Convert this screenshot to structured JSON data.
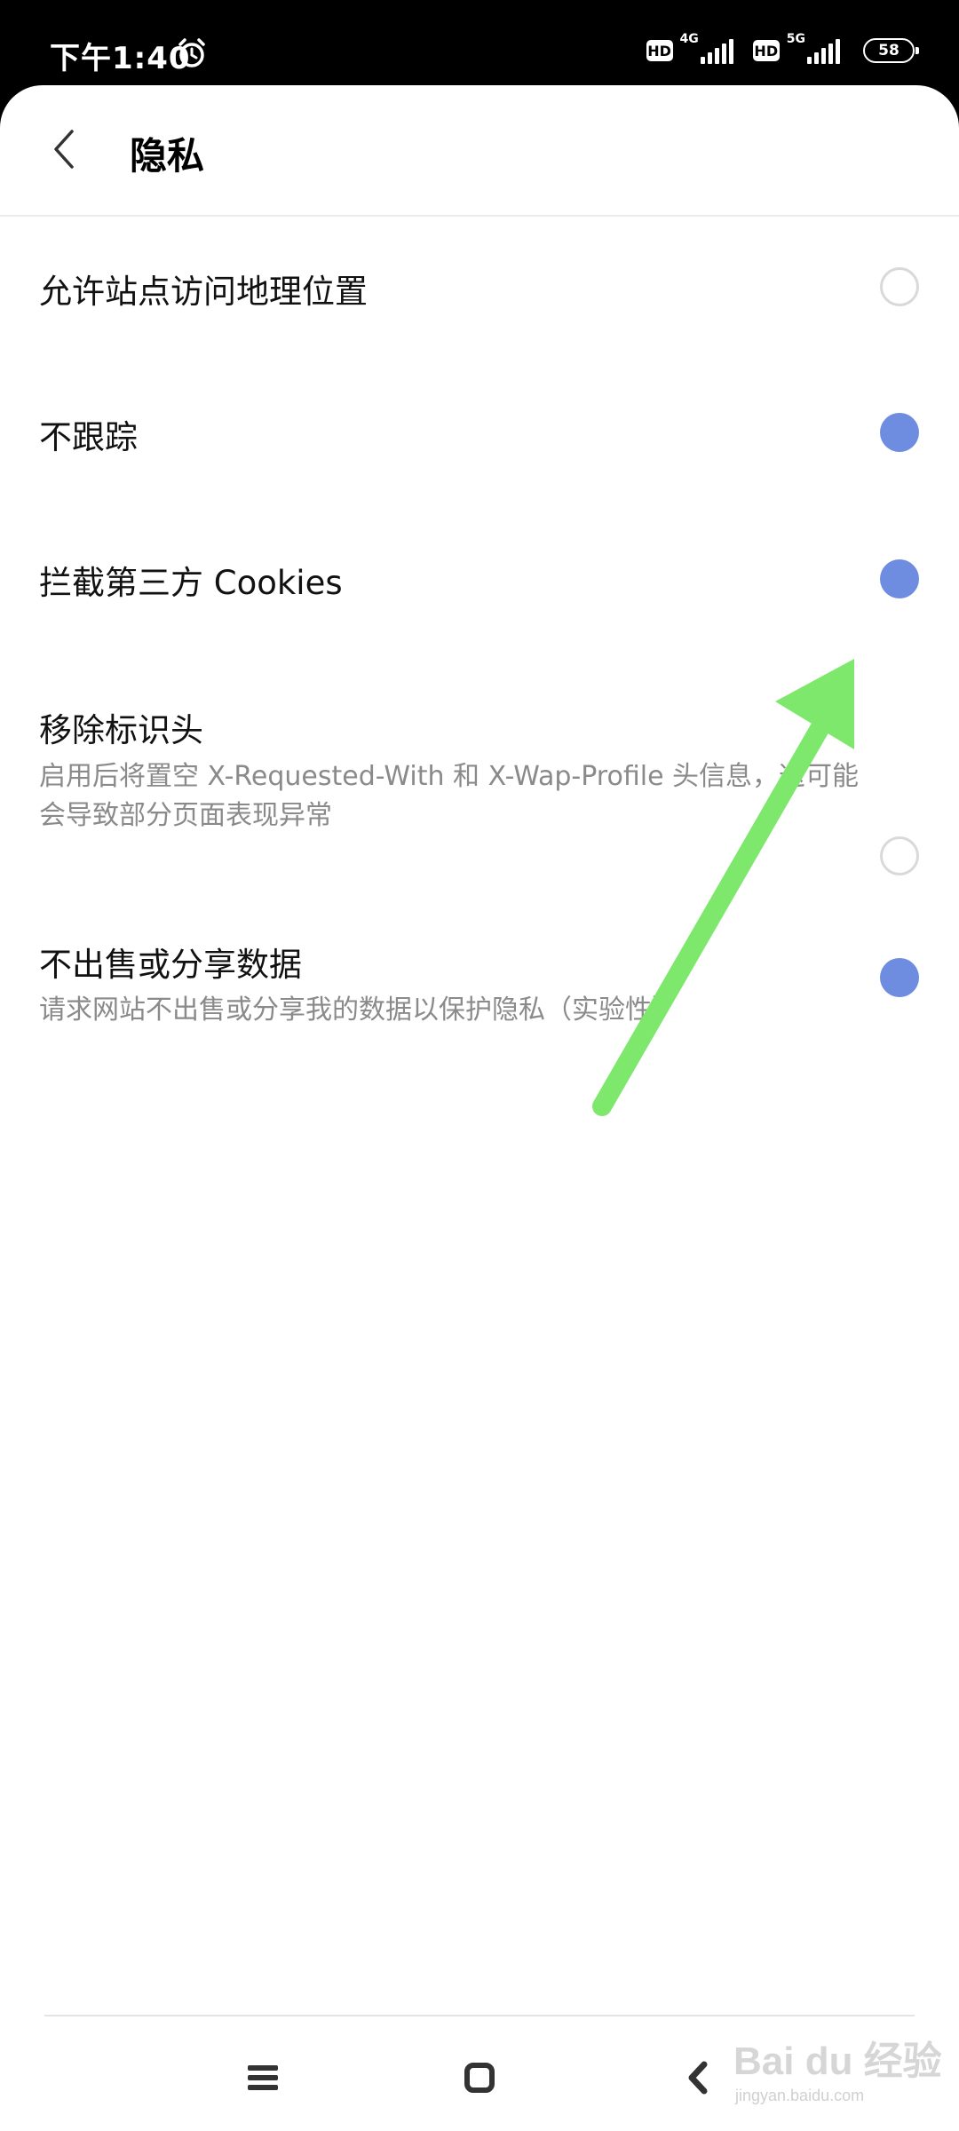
{
  "status_bar": {
    "time": "下午1:40",
    "hd_badge": "HD",
    "network_1": "4G",
    "network_2": "5G",
    "battery": "58"
  },
  "header": {
    "title": "隐私"
  },
  "settings": [
    {
      "title": "允许站点访问地理位置",
      "description": "",
      "enabled": false
    },
    {
      "title": "不跟踪",
      "description": "",
      "enabled": true
    },
    {
      "title": "拦截第三方 Cookies",
      "description": "",
      "enabled": true
    },
    {
      "title": "移除标识头",
      "description": "启用后将置空 X-Requested-With 和 X-Wap-Profile 头信息，这可能会导致部分页面表现异常",
      "enabled": false
    },
    {
      "title": "不出售或分享数据",
      "description": "请求网站不出售或分享我的数据以保护隐私（实验性）",
      "enabled": true
    }
  ],
  "colors": {
    "radio_on": "#6e8de0",
    "radio_off_border": "#d9d9d9",
    "annotation_arrow": "#7de86c"
  },
  "icons": {
    "back": "chevron-left-icon",
    "alarm": "alarm-clock-icon",
    "nav_menu": "menu-icon",
    "nav_home": "square-home-icon",
    "nav_back": "chevron-left-icon"
  },
  "watermark": {
    "main": "Bai du 经验",
    "sub": "jingyan.baidu.com"
  }
}
